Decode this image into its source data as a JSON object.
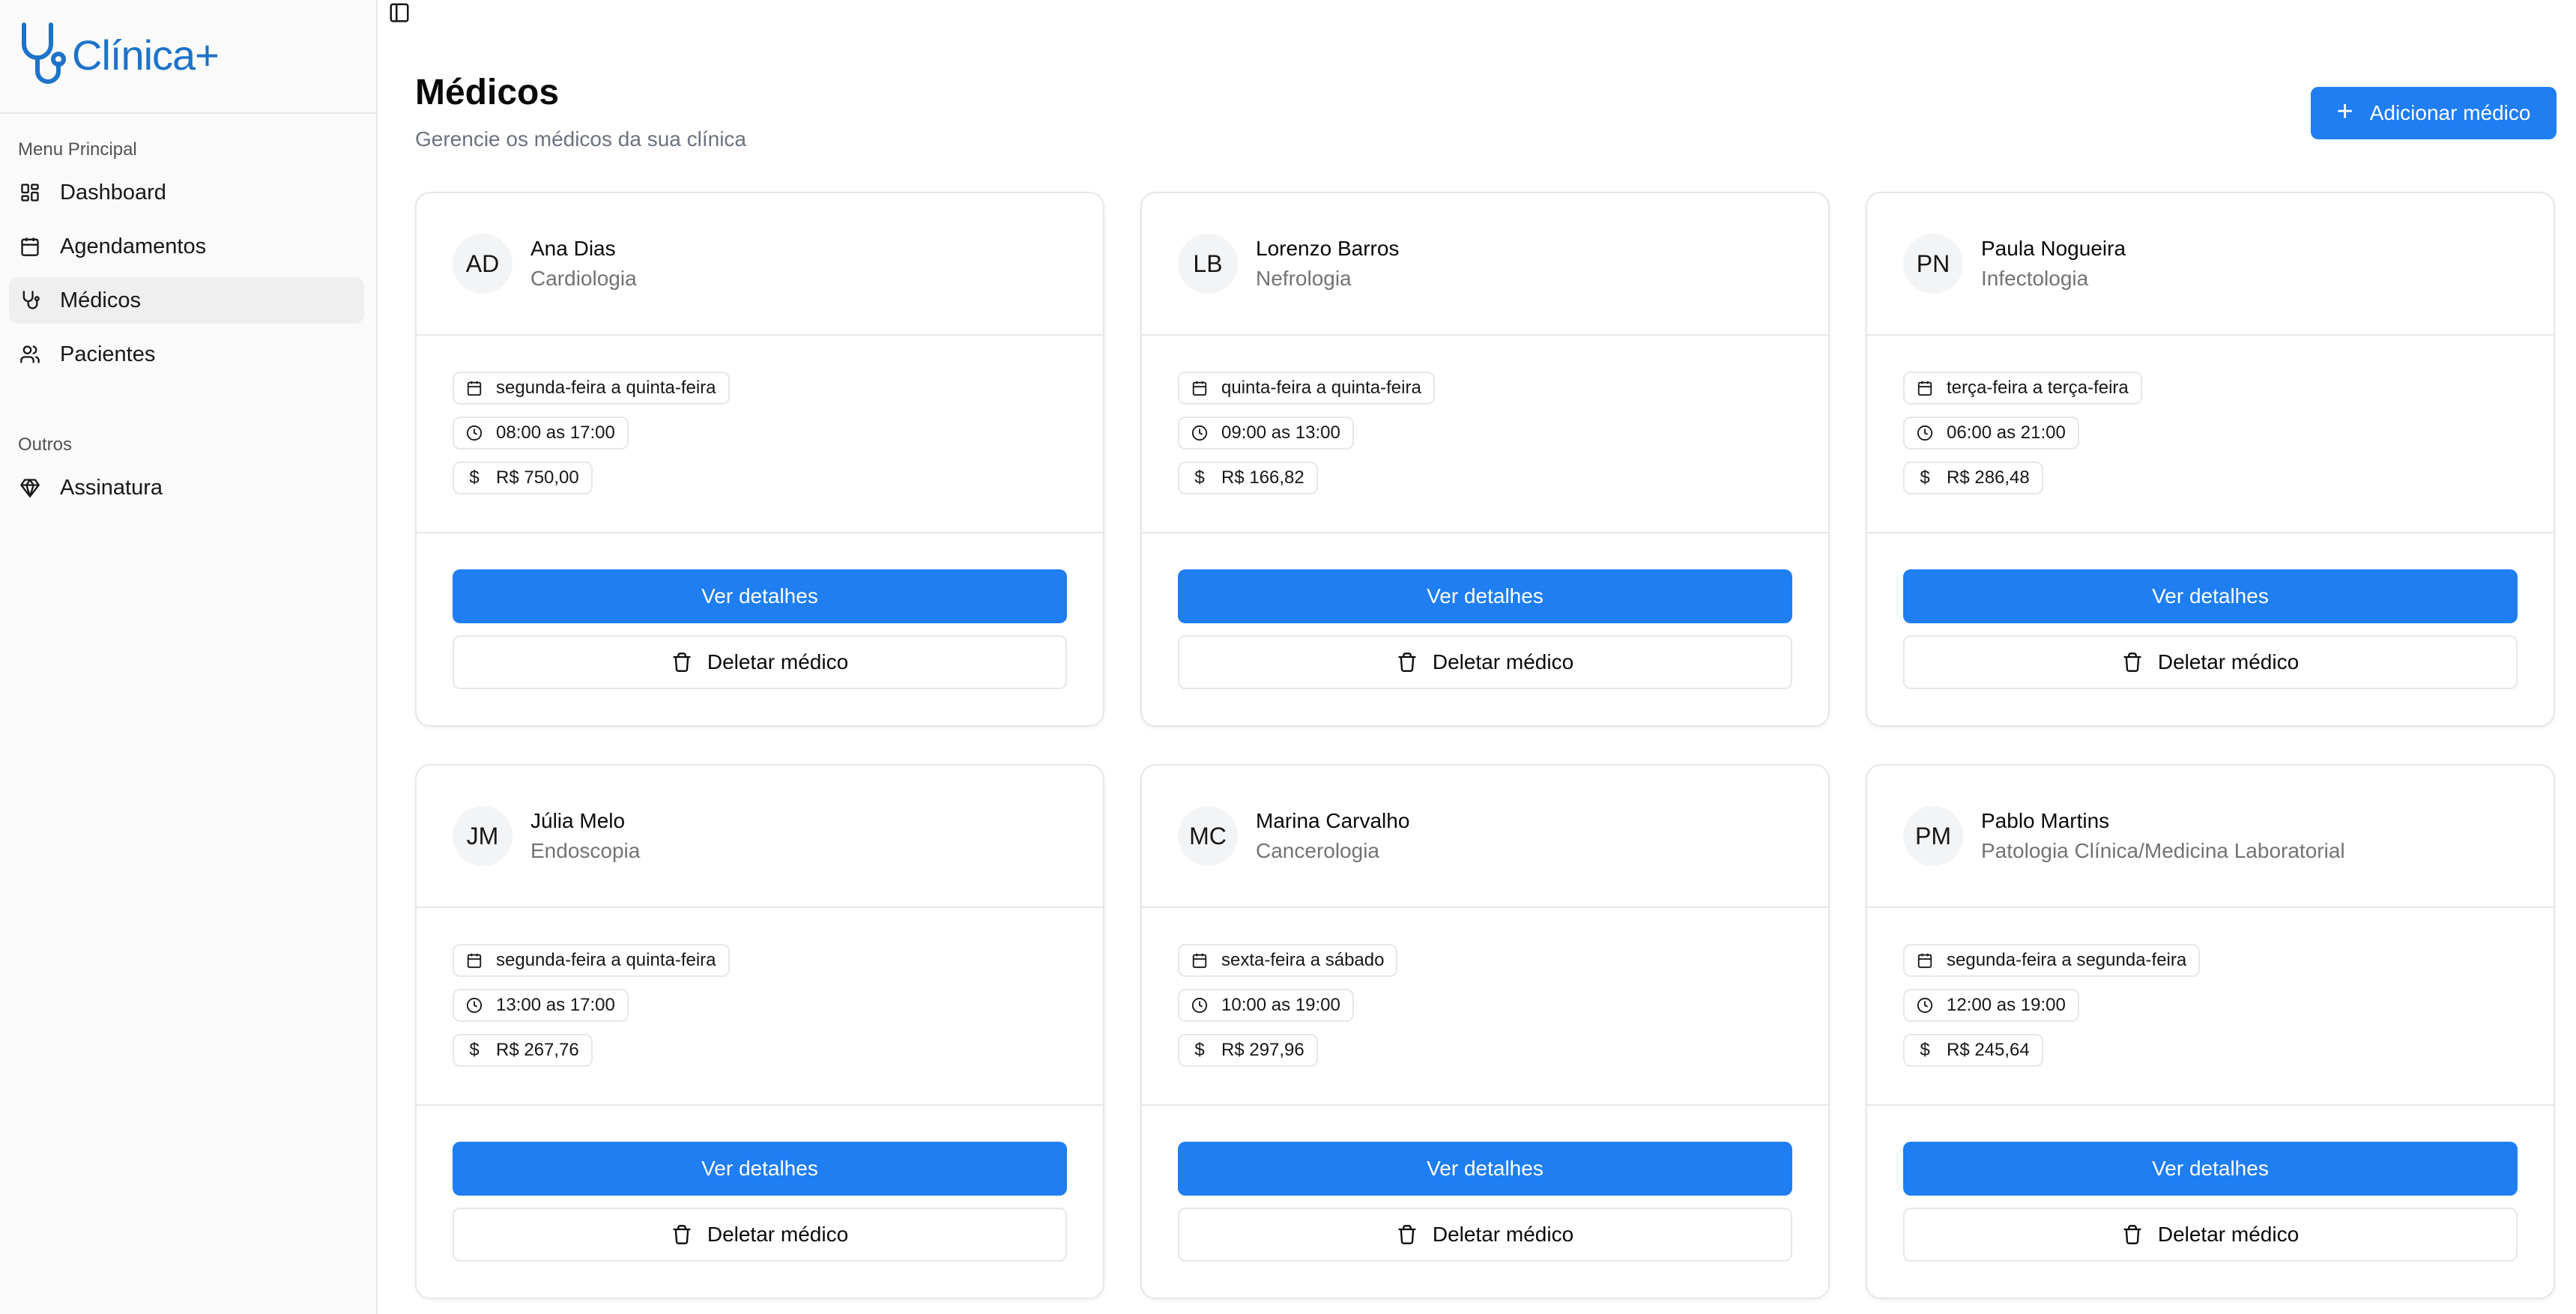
{
  "app": {
    "name": "Clínica+",
    "brand_color": "#1c73c9",
    "accent_color": "#1e7ef2"
  },
  "sidebar": {
    "group_main": "Menu Principal",
    "group_other": "Outros",
    "items": [
      {
        "label": "Dashboard",
        "icon": "layout-dashboard-icon"
      },
      {
        "label": "Agendamentos",
        "icon": "calendar-icon"
      },
      {
        "label": "Médicos",
        "icon": "stethoscope-icon",
        "active": true
      },
      {
        "label": "Pacientes",
        "icon": "users-icon"
      }
    ],
    "other_items": [
      {
        "label": "Assinatura",
        "icon": "gem-icon"
      }
    ]
  },
  "header": {
    "title": "Médicos",
    "subtitle": "Gerencie os médicos da sua clínica",
    "add_button": "Adicionar médico"
  },
  "card_labels": {
    "details": "Ver detalhes",
    "delete": "Deletar médico"
  },
  "doctors": [
    {
      "initials": "AD",
      "name": "Ana Dias",
      "specialty": "Cardiologia",
      "days": "segunda-feira a quinta-feira",
      "hours": "08:00 as 17:00",
      "price": "R$ 750,00"
    },
    {
      "initials": "LB",
      "name": "Lorenzo Barros",
      "specialty": "Nefrologia",
      "days": "quinta-feira a quinta-feira",
      "hours": "09:00 as 13:00",
      "price": "R$ 166,82"
    },
    {
      "initials": "PN",
      "name": "Paula Nogueira",
      "specialty": "Infectologia",
      "days": "terça-feira a terça-feira",
      "hours": "06:00 as 21:00",
      "price": "R$ 286,48"
    },
    {
      "initials": "JM",
      "name": "Júlia Melo",
      "specialty": "Endoscopia",
      "days": "segunda-feira a quinta-feira",
      "hours": "13:00 as 17:00",
      "price": "R$ 267,76"
    },
    {
      "initials": "MC",
      "name": "Marina Carvalho",
      "specialty": "Cancerologia",
      "days": "sexta-feira a sábado",
      "hours": "10:00 as 19:00",
      "price": "R$ 297,96"
    },
    {
      "initials": "PM",
      "name": "Pablo Martins",
      "specialty": "Patologia Clínica/Medicina Laboratorial",
      "days": "segunda-feira a segunda-feira",
      "hours": "12:00 as 19:00",
      "price": "R$ 245,64"
    }
  ]
}
